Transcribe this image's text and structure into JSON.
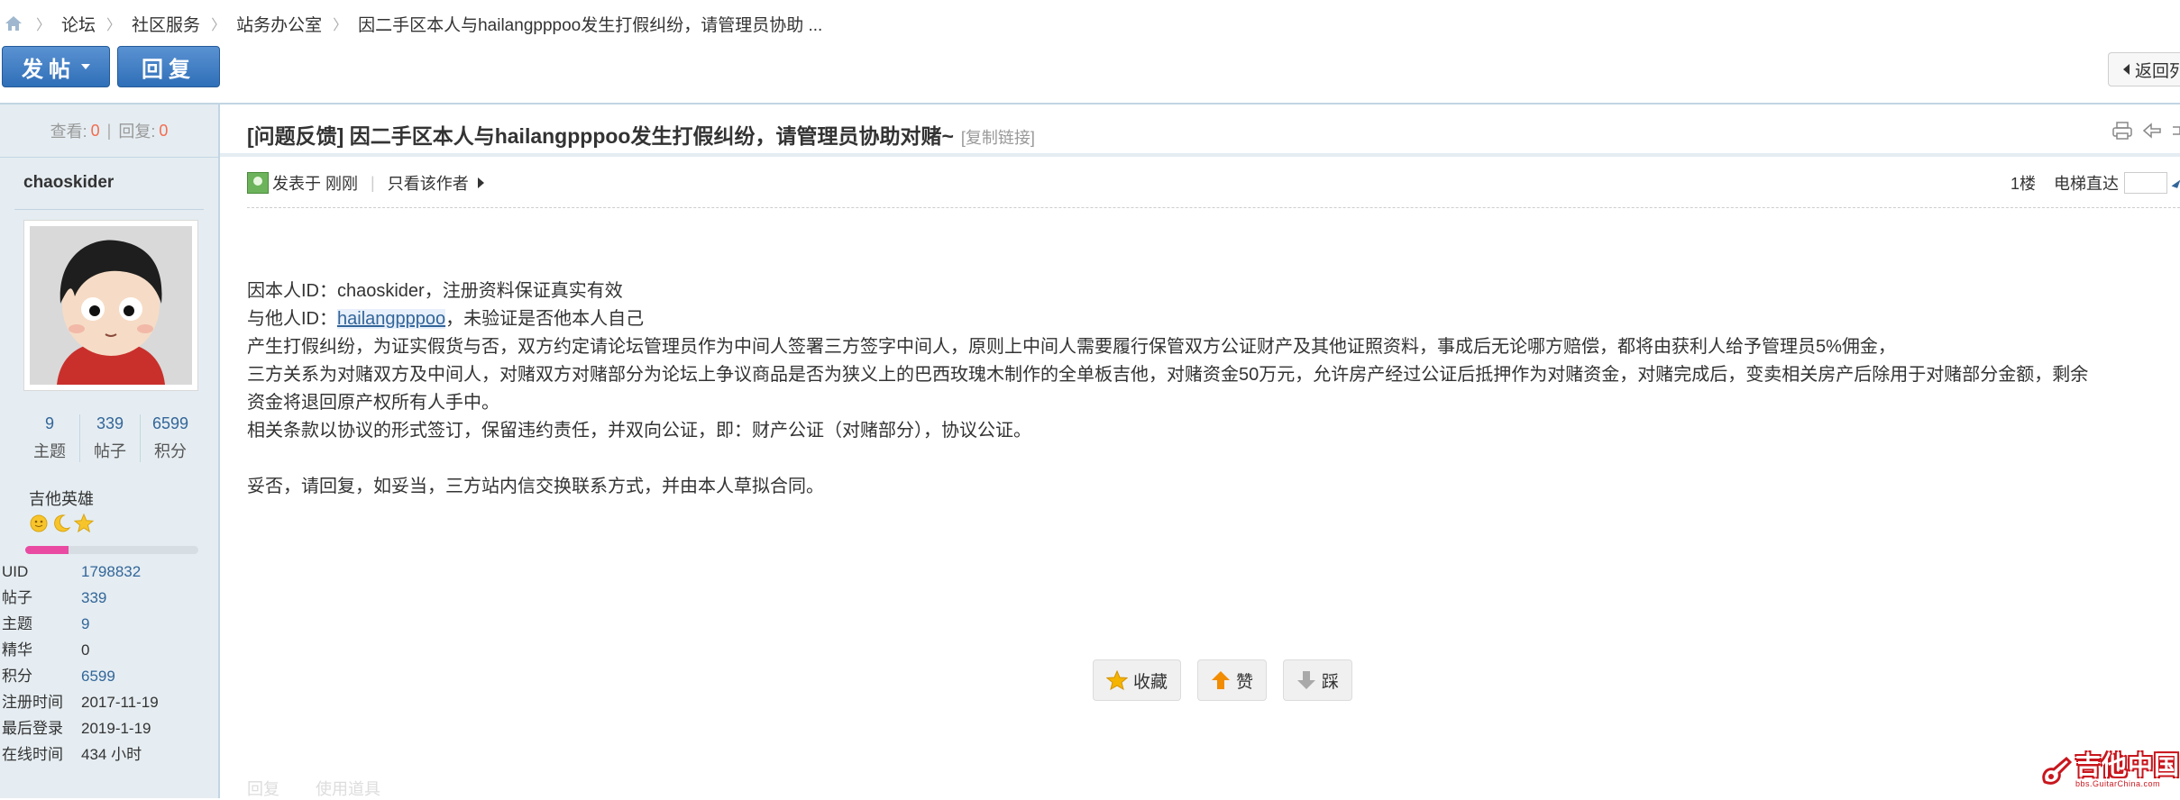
{
  "breadcrumb": {
    "items": [
      "论坛",
      "社区服务",
      "站务办公室",
      "因二手区本人与hailangpppoo发生打假纠纷，请管理员协助 ..."
    ]
  },
  "toolbar": {
    "post_label": "发帖",
    "reply_label": "回复",
    "back_label": "返回列"
  },
  "sidebar": {
    "views_label": "查看:",
    "views": "0",
    "replies_label": "回复:",
    "replies": "0",
    "username": "chaoskider",
    "counts": [
      {
        "value": "9",
        "label": "主题"
      },
      {
        "value": "339",
        "label": "帖子"
      },
      {
        "value": "6599",
        "label": "积分"
      }
    ],
    "group": "吉他英雄",
    "level_progress": 0.25,
    "info": [
      {
        "key": "UID",
        "value": "1798832",
        "link": true
      },
      {
        "key": "帖子",
        "value": "339",
        "link": true
      },
      {
        "key": "主题",
        "value": "9",
        "link": true
      },
      {
        "key": "精华",
        "value": "0",
        "link": false
      },
      {
        "key": "积分",
        "value": "6599",
        "link": true
      },
      {
        "key": "注册时间",
        "value": "2017-11-19",
        "link": false
      },
      {
        "key": "最后登录",
        "value": "2019-1-19",
        "link": false
      },
      {
        "key": "在线时间",
        "value": "434 小时",
        "link": false
      }
    ]
  },
  "post": {
    "title": "[问题反馈] 因二手区本人与hailangpppoo发生打假纠纷，请管理员协助对赌~",
    "copy_link": "[复制链接]",
    "posted_prefix": "发表于",
    "posted_time": "刚刚",
    "only_author": "只看该作者",
    "floor": "1楼",
    "jump_label": "电梯直达",
    "lines": {
      "l1": "因本人ID：chaoskider，注册资料保证真实有效",
      "l2_prefix": "与他人ID：",
      "l2_mention": "hailangpppoo",
      "l2_suffix": "，未验证是否他本人自己",
      "l3": "产生打假纠纷，为证实假货与否，双方约定请论坛管理员作为中间人签署三方签字中间人，原则上中间人需要履行保管双方公证财产及其他证照资料，事成后无论哪方赔偿，都将由获利人给予管理员5%佣金，",
      "l4": "三方关系为对赌双方及中间人，对赌双方对赌部分为论坛上争议商品是否为狭义上的巴西玫瑰木制作的全单板吉他，对赌资金50万元，允许房产经过公证后抵押作为对赌资金，对赌完成后，变卖相关房产后除用于对赌部分金额，剩余",
      "l5": "资金将退回原产权所有人手中。",
      "l6": "相关条款以协议的形式签订，保留违约责任，并双向公证，即：财产公证（对赌部分），协议公证。",
      "l7": "妥否，请回复，如妥当，三方站内信交换联系方式，并由本人草拟合同。"
    },
    "actions": {
      "favorite": "收藏",
      "like": "赞",
      "dislike": "踩"
    },
    "faded": [
      "回复",
      "使用道具"
    ]
  },
  "watermark": {
    "name": "吉他中国",
    "url": "bbs.GuitarChina.com"
  },
  "colors": {
    "accent": "#336699",
    "button": "#2f6fb8",
    "sidebar_bg": "#e5edf2",
    "count_red": "#f26c4f",
    "brand_red": "#c8161d"
  }
}
